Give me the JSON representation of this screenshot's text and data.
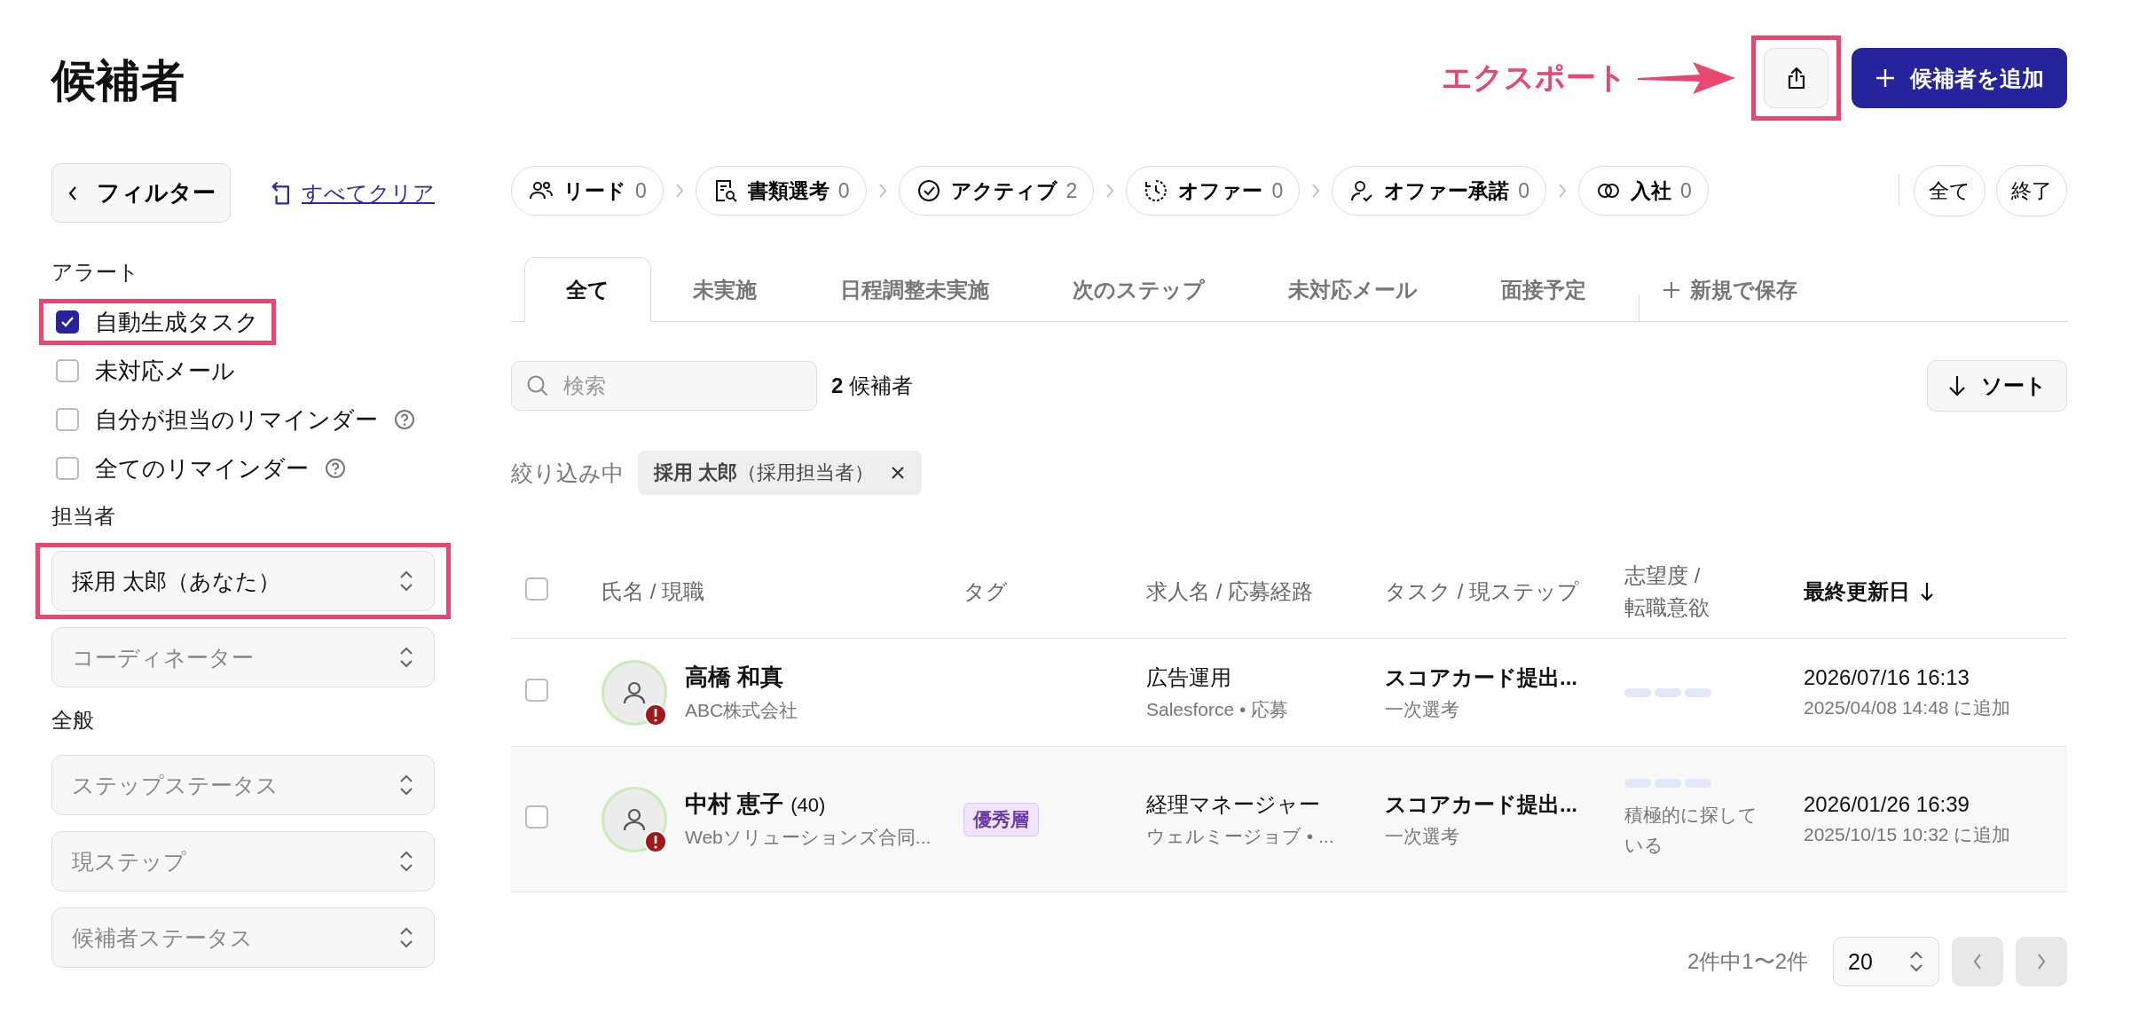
{
  "page": {
    "title": "候補者"
  },
  "annotation": {
    "label": "エクスポート"
  },
  "header_actions": {
    "export_highlighted": true,
    "add_button": "候補者を追加"
  },
  "sidebar": {
    "filter_button": "フィルター",
    "clear_link": "すべてクリア",
    "sections": [
      {
        "title": "アラート",
        "kind": "checkboxes",
        "items": [
          {
            "label": "自動生成タスク",
            "checked": true,
            "help": false,
            "highlighted": true
          },
          {
            "label": "未対応メール",
            "checked": false,
            "help": false,
            "highlighted": false
          },
          {
            "label": "自分が担当のリマインダー",
            "checked": false,
            "help": true,
            "highlighted": false
          },
          {
            "label": "全てのリマインダー",
            "checked": false,
            "help": true,
            "highlighted": false
          }
        ]
      },
      {
        "title": "担当者",
        "kind": "selects",
        "items": [
          {
            "value": "採用 太郎（あなた）",
            "highlighted": true
          },
          {
            "placeholder": "コーディネーター",
            "highlighted": false
          }
        ]
      },
      {
        "title": "全般",
        "kind": "selects",
        "items": [
          {
            "placeholder": "ステップステータス",
            "highlighted": false
          },
          {
            "placeholder": "現ステップ",
            "highlighted": false
          },
          {
            "placeholder": "候補者ステータス",
            "highlighted": false
          }
        ]
      }
    ]
  },
  "pipeline": {
    "stages": [
      {
        "label": "リード",
        "count": "0"
      },
      {
        "label": "書類選考",
        "count": "0"
      },
      {
        "label": "アクティブ",
        "count": "2"
      },
      {
        "label": "オファー",
        "count": "0"
      },
      {
        "label": "オファー承諾",
        "count": "0"
      },
      {
        "label": "入社",
        "count": "0"
      }
    ],
    "extra_buttons": [
      "全て",
      "終了"
    ]
  },
  "tabs": [
    {
      "label": "全て",
      "selected": true
    },
    {
      "label": "未実施",
      "selected": false
    },
    {
      "label": "日程調整未実施",
      "selected": false
    },
    {
      "label": "次のステップ",
      "selected": false
    },
    {
      "label": "未対応メール",
      "selected": false
    },
    {
      "label": "面接予定",
      "selected": false
    }
  ],
  "save_view": "新規で保存",
  "search": {
    "placeholder": "検索"
  },
  "result_count": "**2** 候補者",
  "sort_button": "ソート",
  "active_filters": {
    "label": "絞り込み中",
    "chips": [
      "**採用 太郎**（採用担当者）"
    ]
  },
  "table": {
    "select_all": {
      "checked": false
    },
    "columns": [
      {
        "label": "氏名 / 現職",
        "sorted": false
      },
      {
        "label": "タグ",
        "sorted": false
      },
      {
        "label": "求人名 / 応募経路",
        "sorted": false
      },
      {
        "label": "タスク / 現ステップ",
        "sorted": false
      },
      {
        "label": "志望度 / 転職意欲",
        "sorted": false
      },
      {
        "label": "最終更新日",
        "sorted": true
      }
    ],
    "rows": [
      {
        "checked": false,
        "hovered": false,
        "alert": true,
        "name": "高橋 和真",
        "company": "ABC株式会社",
        "tags": [],
        "job": "広告運用",
        "source": "Salesforce • 応募",
        "task": "スコアカード提出...",
        "step": "一次選考",
        "updated": "2026/07/16 16:13",
        "added": "2025/04/08 14:48 に追加"
      },
      {
        "checked": false,
        "hovered": true,
        "alert": true,
        "name": "中村 恵子",
        "age": "(40)",
        "company": "Webソリューションズ合同...",
        "tags": [
          {
            "label": "優秀層"
          }
        ],
        "job": "経理マネージャー",
        "source": "ウェルミージョブ • ...",
        "task": "スコアカード提出...",
        "step": "一次選考",
        "interest": "積極的に探している",
        "updated": "2026/01/26 16:39",
        "added": "2025/10/15 10:32 に追加"
      }
    ]
  },
  "pagination": {
    "summary": "2件中1〜2件",
    "page_size": "20",
    "prev_disabled": true,
    "next_disabled": true
  }
}
